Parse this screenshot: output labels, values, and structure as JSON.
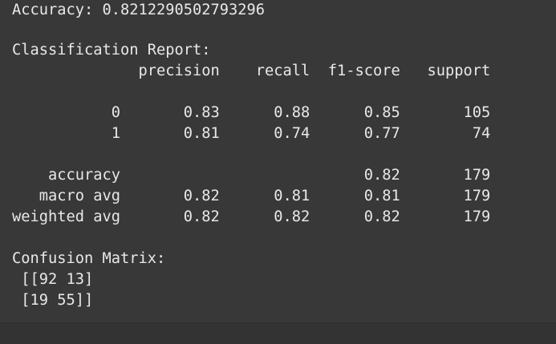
{
  "output": {
    "accuracy_line": "Accuracy: 0.8212290502793296",
    "report_title": "Classification Report:",
    "report_header": "              precision    recall  f1-score   support",
    "report_rows": [
      "           0       0.83      0.88      0.85       105",
      "           1       0.81      0.74      0.77        74",
      "    accuracy                           0.82       179",
      "   macro avg       0.82      0.81      0.81       179",
      "weighted avg       0.82      0.82      0.82       179"
    ],
    "matrix_title": "Confusion Matrix:",
    "matrix_rows": [
      " [[92 13]",
      " [19 55]]"
    ]
  }
}
